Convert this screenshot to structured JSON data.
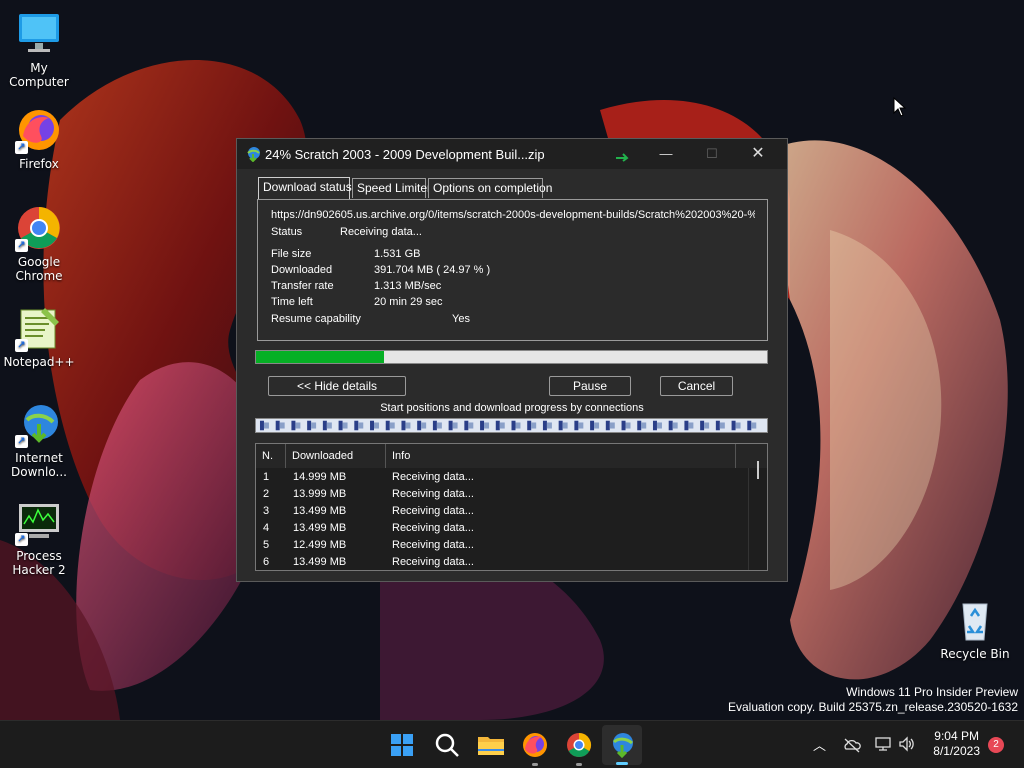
{
  "desktop": {
    "icons": [
      {
        "label": "My Computer",
        "icon": "monitor-icon"
      },
      {
        "label": "Firefox",
        "icon": "firefox-icon"
      },
      {
        "label": "Google Chrome",
        "icon": "chrome-icon"
      },
      {
        "label": "Notepad++",
        "icon": "notepadpp-icon"
      },
      {
        "label": "Internet Downlo...",
        "icon": "idm-icon"
      },
      {
        "label": "Process Hacker 2",
        "icon": "process-hacker-icon"
      },
      {
        "label": "Recycle Bin",
        "icon": "recycle-bin-icon"
      }
    ],
    "watermark": {
      "line1": "Windows 11 Pro Insider Preview",
      "line2": "Evaluation copy. Build 25375.zn_release.230520-1632"
    }
  },
  "dialog": {
    "title": "24% Scratch 2003 - 2009 Development Buil...zip",
    "tabs": [
      {
        "label": "Download status",
        "active": true
      },
      {
        "label": "Speed Limiter",
        "active": false
      },
      {
        "label": "Options on completion",
        "active": false
      }
    ],
    "url": "https://dn902605.us.archive.org/0/items/scratch-2000s-development-builds/Scratch%202003%20-%",
    "status_label": "Status",
    "status_value": "Receiving data...",
    "file_size_label": "File size",
    "file_size_value": "1.531  GB",
    "downloaded_label": "Downloaded",
    "downloaded_value": "391.704  MB  ( 24.97 % )",
    "transfer_rate_label": "Transfer rate",
    "transfer_rate_value": "1.313  MB/sec",
    "time_left_label": "Time left",
    "time_left_value": "20 min 29 sec",
    "resume_label": "Resume capability",
    "resume_value": "Yes",
    "progress_fraction": 0.2497,
    "buttons": {
      "hide_details": "<< Hide details",
      "pause": "Pause",
      "cancel": "Cancel"
    },
    "connections_caption": "Start positions and download progress by connections",
    "table": {
      "headers": [
        "N.",
        "Downloaded",
        "Info"
      ],
      "rows": [
        {
          "n": "1",
          "downloaded": "14.999  MB",
          "info": "Receiving data..."
        },
        {
          "n": "2",
          "downloaded": "13.999  MB",
          "info": "Receiving data..."
        },
        {
          "n": "3",
          "downloaded": "13.499  MB",
          "info": "Receiving data..."
        },
        {
          "n": "4",
          "downloaded": "13.499  MB",
          "info": "Receiving data..."
        },
        {
          "n": "5",
          "downloaded": "12.499  MB",
          "info": "Receiving data..."
        },
        {
          "n": "6",
          "downloaded": "13.499  MB",
          "info": "Receiving data..."
        }
      ]
    }
  },
  "taskbar": {
    "apps": [
      "windows-start-icon",
      "search-icon",
      "file-explorer-icon",
      "firefox-icon",
      "chrome-icon",
      "idm-icon"
    ],
    "time": "9:04 PM",
    "date": "8/1/2023",
    "notification_count": "2"
  },
  "colors": {
    "progress": "#06b025",
    "accent": "#0078d4",
    "notify": "#e74856"
  }
}
